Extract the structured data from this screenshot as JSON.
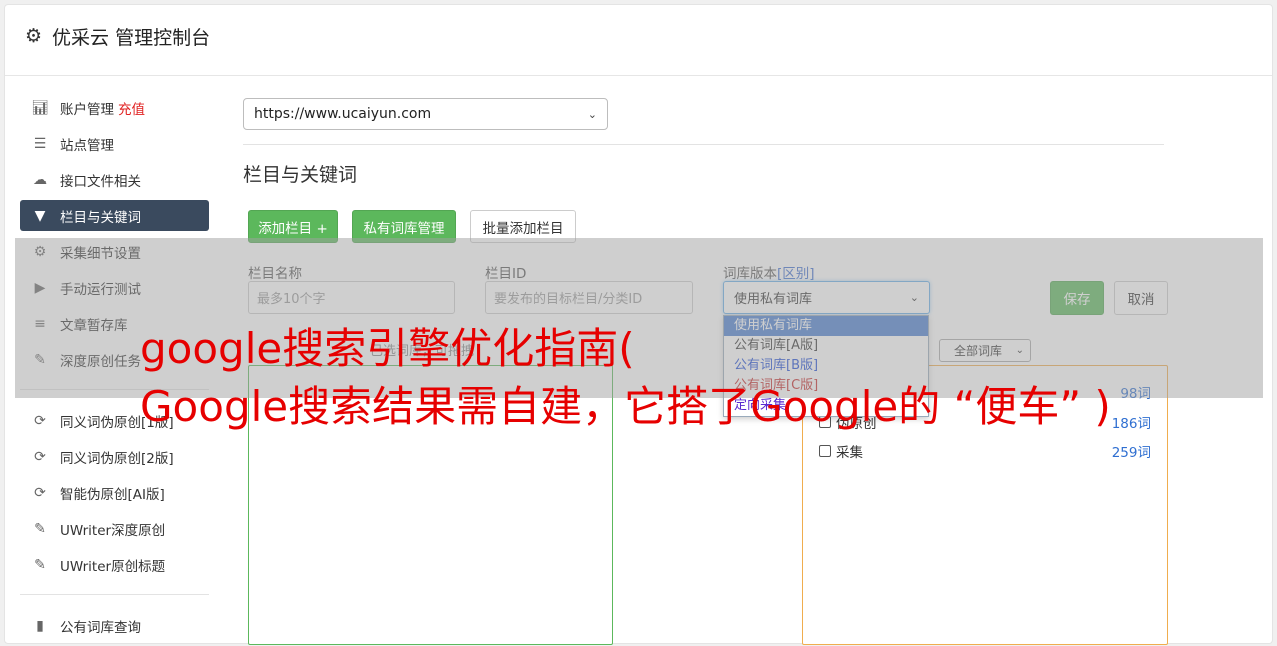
{
  "header": {
    "title": "优采云 管理控制台",
    "icon": "gear-icon"
  },
  "sidebar": {
    "group1": [
      {
        "label": "账户管理",
        "badge": "充值",
        "icon": "bar-chart-icon"
      },
      {
        "label": "站点管理",
        "icon": "server-icon"
      },
      {
        "label": "接口文件相关",
        "icon": "cloud-upload-icon"
      },
      {
        "label": "栏目与关键词",
        "icon": "filter-icon",
        "active": true
      },
      {
        "label": "采集细节设置",
        "icon": "cogs-icon"
      },
      {
        "label": "手动运行测试",
        "icon": "play-circle-icon"
      },
      {
        "label": "文章暂存库",
        "icon": "database-icon"
      },
      {
        "label": "深度原创任务",
        "icon": "edit-icon"
      }
    ],
    "group2": [
      {
        "label": "同义词伪原创[1版]",
        "icon": "refresh-icon"
      },
      {
        "label": "同义词伪原创[2版]",
        "icon": "refresh-icon"
      },
      {
        "label": "智能伪原创[AI版]",
        "icon": "refresh-icon"
      },
      {
        "label": "UWriter深度原创",
        "icon": "edit-icon"
      },
      {
        "label": "UWriter原创标题",
        "icon": "edit-icon"
      }
    ],
    "group3": [
      {
        "label": "公有词库查询",
        "icon": "book-icon"
      }
    ]
  },
  "main": {
    "site_select": "https://www.ucaiyun.com",
    "section_title": "栏目与关键词",
    "buttons": {
      "add_column": "添加栏目 +",
      "private_lib": "私有词库管理",
      "batch_add": "批量添加栏目"
    },
    "form": {
      "name_label": "栏目名称",
      "name_placeholder": "最多10个字",
      "id_label": "栏目ID",
      "id_placeholder": "要发布的目标栏目/分类ID",
      "version_label": "词库版本",
      "version_link": "[区别]",
      "version_selected": "使用私有词库",
      "version_options": [
        "使用私有词库",
        "公有词库[A版]",
        "公有词库[B版]",
        "公有词库[C版]",
        "定向采集"
      ],
      "save": "保存",
      "cancel": "取消"
    },
    "list_hint": "已选词库，可拖拽",
    "lib_filter": "全部词库",
    "libraries": [
      {
        "name": "",
        "count": "98词"
      },
      {
        "name": "伪原创",
        "count": "186词"
      },
      {
        "name": "采集",
        "count": "259词"
      }
    ]
  },
  "watermark": {
    "line1": "google搜索引擎优化指南(",
    "line2": "Google搜索结果需自建，它搭了Google的 “便车” )"
  }
}
